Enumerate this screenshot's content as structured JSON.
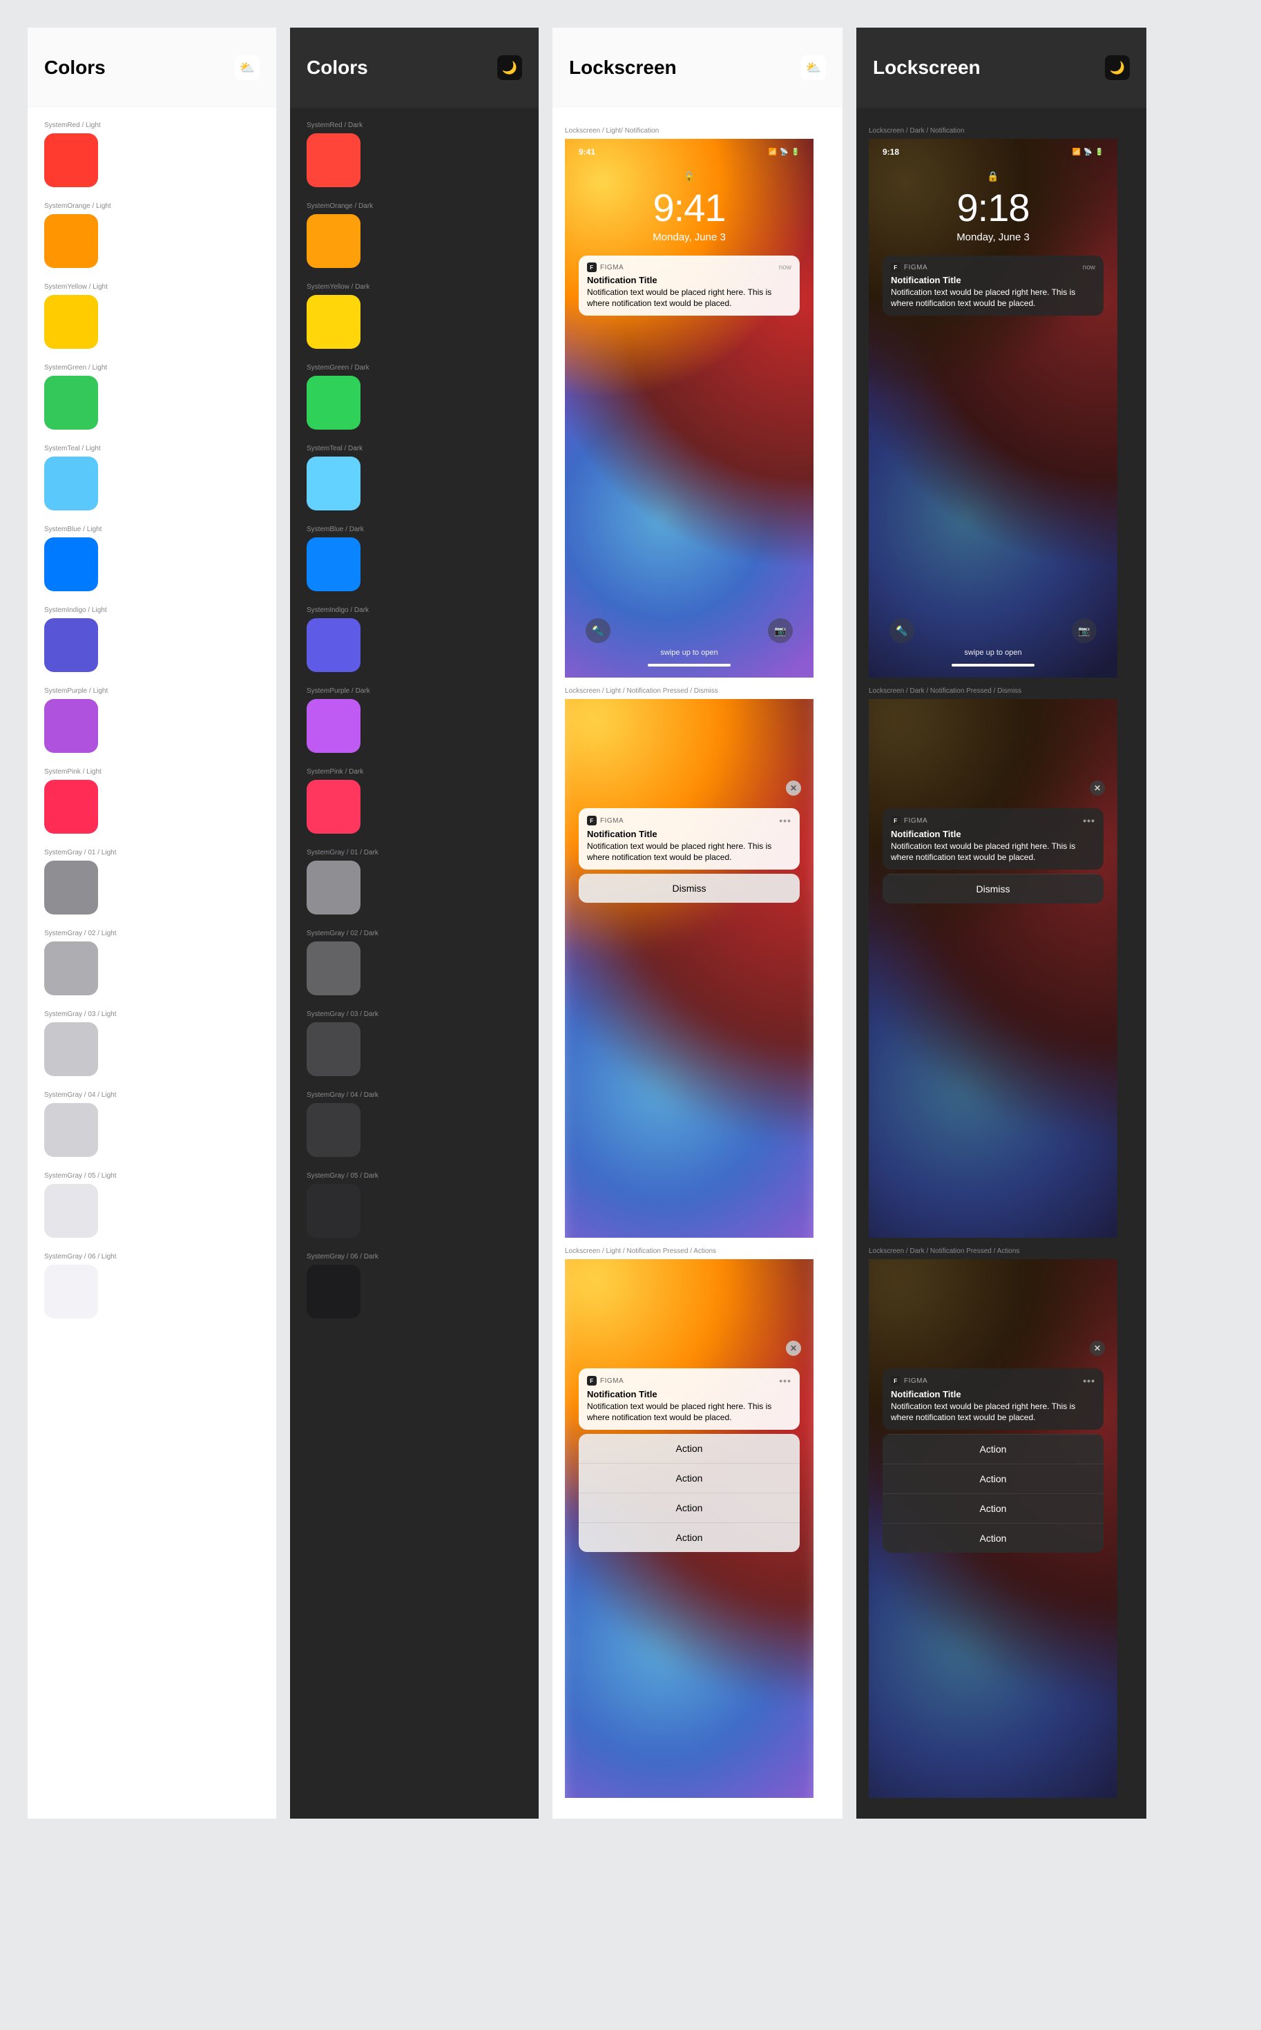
{
  "mode_icons": {
    "light": "⛅",
    "dark": "🌙"
  },
  "sections": {
    "colors_light": {
      "title": "Colors"
    },
    "colors_dark": {
      "title": "Colors"
    },
    "lock_light": {
      "title": "Lockscreen"
    },
    "lock_dark": {
      "title": "Lockscreen"
    }
  },
  "colors_light": [
    {
      "label": "SystemRed / Light",
      "hex": "#FF3B30"
    },
    {
      "label": "SystemOrange / Light",
      "hex": "#FF9500"
    },
    {
      "label": "SystemYellow / Light",
      "hex": "#FFCC00"
    },
    {
      "label": "SystemGreen / Light",
      "hex": "#34C759"
    },
    {
      "label": "SystemTeal / Light",
      "hex": "#5AC8FA"
    },
    {
      "label": "SystemBlue / Light",
      "hex": "#007AFF"
    },
    {
      "label": "SystemIndigo / Light",
      "hex": "#5856D6"
    },
    {
      "label": "SystemPurple / Light",
      "hex": "#AF52DE"
    },
    {
      "label": "SystemPink / Light",
      "hex": "#FF2D55"
    },
    {
      "label": "SystemGray / 01 / Light",
      "hex": "#8E8E93"
    },
    {
      "label": "SystemGray / 02 / Light",
      "hex": "#AEAEB2"
    },
    {
      "label": "SystemGray / 03 / Light",
      "hex": "#C7C7CC"
    },
    {
      "label": "SystemGray / 04 / Light",
      "hex": "#D1D1D6"
    },
    {
      "label": "SystemGray / 05 / Light",
      "hex": "#E5E5EA"
    },
    {
      "label": "SystemGray / 06 / Light",
      "hex": "#F2F2F7"
    }
  ],
  "colors_dark": [
    {
      "label": "SystemRed / Dark",
      "hex": "#FF453A"
    },
    {
      "label": "SystemOrange / Dark",
      "hex": "#FF9F0A"
    },
    {
      "label": "SystemYellow / Dark",
      "hex": "#FFD60A"
    },
    {
      "label": "SystemGreen / Dark",
      "hex": "#30D158"
    },
    {
      "label": "SystemTeal / Dark",
      "hex": "#64D2FF"
    },
    {
      "label": "SystemBlue / Dark",
      "hex": "#0A84FF"
    },
    {
      "label": "SystemIndigo / Dark",
      "hex": "#5E5CE6"
    },
    {
      "label": "SystemPurple / Dark",
      "hex": "#BF5AF2"
    },
    {
      "label": "SystemPink / Dark",
      "hex": "#FF375F"
    },
    {
      "label": "SystemGray / 01 / Dark",
      "hex": "#8E8E93"
    },
    {
      "label": "SystemGray / 02 / Dark",
      "hex": "#636366"
    },
    {
      "label": "SystemGray / 03 / Dark",
      "hex": "#48484A"
    },
    {
      "label": "SystemGray / 04 / Dark",
      "hex": "#3A3A3C"
    },
    {
      "label": "SystemGray / 05 / Dark",
      "hex": "#2C2C2E"
    },
    {
      "label": "SystemGray / 06 / Dark",
      "hex": "#1C1C1E"
    }
  ],
  "frames_light": {
    "notification": {
      "label": "Lockscreen / Light/ Notification"
    },
    "dismiss": {
      "label": "Lockscreen / Light / Notification Pressed / Dismiss"
    },
    "actions": {
      "label": "Lockscreen / Light / Notification Pressed / Actions"
    }
  },
  "frames_dark": {
    "notification": {
      "label": "Lockscreen / Dark / Notification"
    },
    "dismiss": {
      "label": "Lockscreen / Dark / Notification Pressed / Dismiss"
    },
    "actions": {
      "label": "Lockscreen / Dark / Notification Pressed / Actions"
    }
  },
  "lock": {
    "status_time_light": "9:41",
    "status_time_dark": "9:18",
    "signal": "▮▮▮▮",
    "wifi": "📶",
    "battery": "▬",
    "time_light": "9:41",
    "time_dark": "9:18",
    "date": "Monday, June 3",
    "swipe": "swipe up to open"
  },
  "notification": {
    "app": "FIGMA",
    "when": "now",
    "title": "Notification Title",
    "body": "Notification text would be placed right here. This is where notification text would be placed.",
    "dismiss": "Dismiss",
    "action": "Action",
    "close": "✕",
    "more": "•••"
  }
}
